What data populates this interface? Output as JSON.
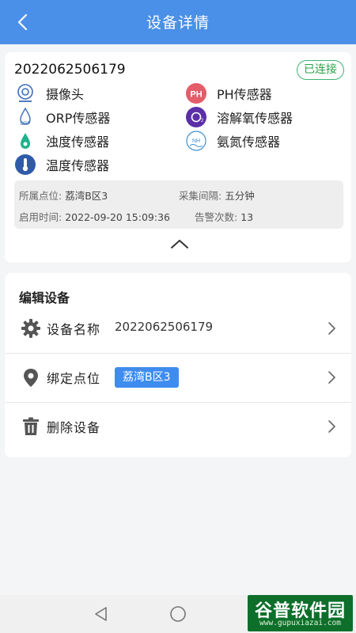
{
  "header": {
    "title": "设备详情"
  },
  "device": {
    "id": "2022062506179",
    "status": "已连接",
    "sensors": [
      {
        "icon": "camera-icon",
        "label": "摄像头"
      },
      {
        "icon": "ph-sensor-icon",
        "label": "PH传感器"
      },
      {
        "icon": "orp-sensor-icon",
        "label": "ORP传感器"
      },
      {
        "icon": "dissolved-oxygen-icon",
        "label": "溶解氧传感器"
      },
      {
        "icon": "turbidity-sensor-icon",
        "label": "浊度传感器"
      },
      {
        "icon": "ammonia-sensor-icon",
        "label": "氨氮传感器"
      },
      {
        "icon": "thermometer-icon",
        "label": "温度传感器"
      }
    ],
    "info": {
      "location_label": "所属点位:",
      "location_value": "荔湾B区3",
      "interval_label": "采集间隔:",
      "interval_value": "五分钟",
      "start_label": "启用时间:",
      "start_value": "2022-09-20 15:09:36",
      "alarm_label": "告警次数:",
      "alarm_value": "13"
    }
  },
  "edit": {
    "title": "编辑设备",
    "name_label": "设备名称",
    "name_value": "2022062506179",
    "bind_label": "绑定点位",
    "bind_value": "荔湾B区3",
    "delete_label": "删除设备"
  },
  "watermark": {
    "main": "谷普软件园",
    "sub": "www.gupuxiazai.com"
  },
  "colors": {
    "header": "#4a90e8",
    "status": "#2aa34a",
    "tag": "#3f8cf0"
  },
  "icons": [
    "back-arrow-icon",
    "chevron-up-icon",
    "gear-icon",
    "location-pin-icon",
    "trash-icon",
    "chevron-right-icon",
    "nav-back-icon",
    "nav-home-icon"
  ]
}
